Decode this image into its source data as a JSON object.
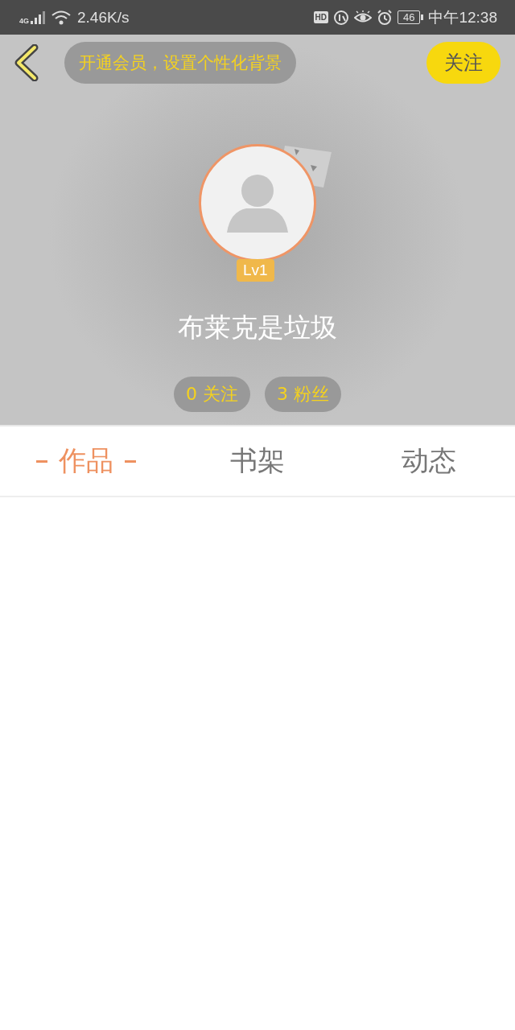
{
  "status_bar": {
    "network_type": "4G",
    "speed": "2.46K/s",
    "hd_label": "HD",
    "battery": "46",
    "time": "中午12:38"
  },
  "header": {
    "vip_banner": "开通会员，设置个性化背景",
    "follow_button": "关注",
    "level_badge": "Lv1",
    "username": "布莱克是垃圾",
    "stats": [
      {
        "label": "0 关注"
      },
      {
        "label": "3 粉丝"
      }
    ]
  },
  "tabs": [
    {
      "label": "作品",
      "selected": true
    },
    {
      "label": "书架",
      "selected": false
    },
    {
      "label": "动态",
      "selected": false
    }
  ]
}
